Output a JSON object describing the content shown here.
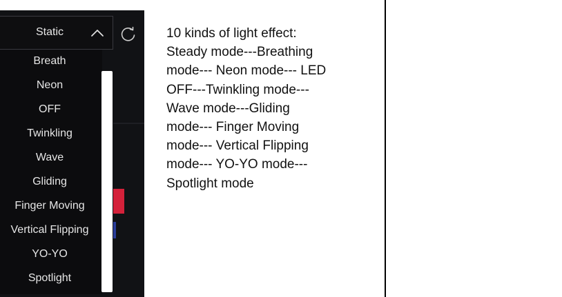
{
  "dropdown": {
    "selected_label": "Static",
    "options": [
      "Breath",
      "Neon",
      "OFF",
      "Twinkling",
      "Wave",
      "Gliding",
      "Finger Moving",
      "Vertical Flipping",
      "YO-YO",
      "Spotlight"
    ],
    "icons": {
      "collapse": "chevron-up-icon",
      "refresh": "refresh-icon"
    }
  },
  "description": {
    "lines": [
      "10 kinds of light effect:",
      "Steady mode---Breathing",
      "mode--- Neon mode--- LED",
      "OFF---Twinkling mode---",
      "Wave mode---Gliding",
      "mode--- Finger Moving",
      "mode--- Vertical Flipping",
      "mode--- YO-YO mode---",
      "Spotlight mode"
    ]
  },
  "colors": {
    "panel_bg": "#111215",
    "menu_bg": "#0c0c0e",
    "menu_text": "#e6e6e6",
    "accent_red": "#d4213a",
    "accent_blue": "#2a3d9a"
  }
}
